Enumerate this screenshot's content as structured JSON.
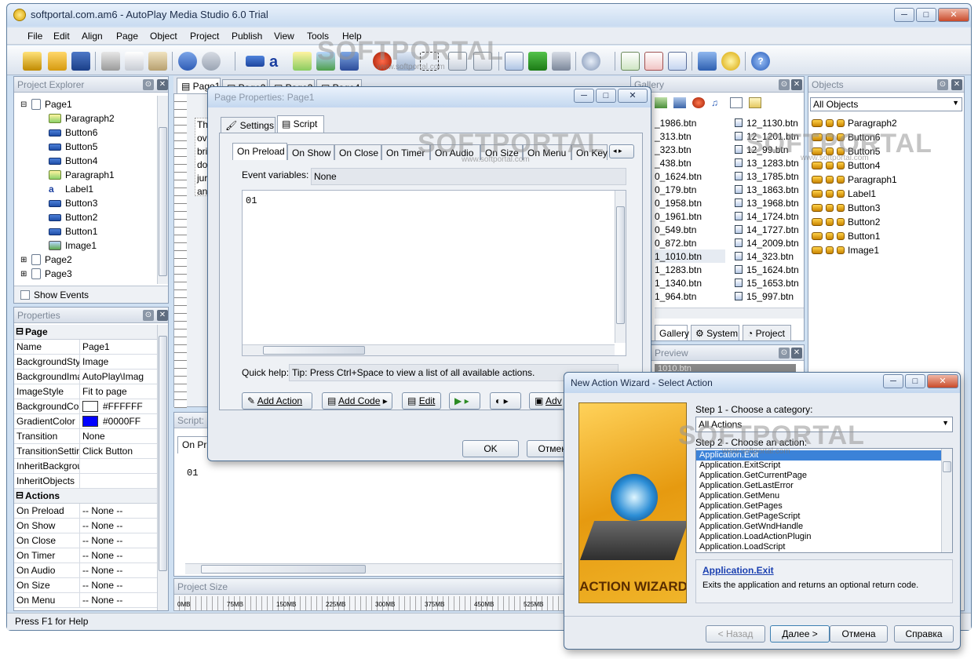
{
  "window": {
    "title": "softportal.com.am6 - AutoPlay Media Studio 6.0 Trial"
  },
  "menu": [
    "File",
    "Edit",
    "Align",
    "Page",
    "Object",
    "Project",
    "Publish",
    "View",
    "Tools",
    "Help"
  ],
  "project_explorer": {
    "title": "Project Explorer",
    "tree": [
      {
        "label": "Page1",
        "icon": "page",
        "level": 0
      },
      {
        "label": "Paragraph2",
        "icon": "paragraph",
        "level": 1
      },
      {
        "label": "Button6",
        "icon": "button",
        "level": 1
      },
      {
        "label": "Button5",
        "icon": "button",
        "level": 1
      },
      {
        "label": "Button4",
        "icon": "button",
        "level": 1
      },
      {
        "label": "Paragraph1",
        "icon": "paragraph",
        "level": 1
      },
      {
        "label": "Label1",
        "icon": "label",
        "level": 1
      },
      {
        "label": "Button3",
        "icon": "button",
        "level": 1
      },
      {
        "label": "Button2",
        "icon": "button",
        "level": 1
      },
      {
        "label": "Button1",
        "icon": "button",
        "level": 1
      },
      {
        "label": "Image1",
        "icon": "image",
        "level": 1
      },
      {
        "label": "Page2",
        "icon": "page",
        "level": 0
      },
      {
        "label": "Page3",
        "icon": "page",
        "level": 0
      }
    ],
    "show_events": "Show Events"
  },
  "properties": {
    "title": "Properties",
    "group_page": "Page",
    "rows": [
      {
        "name": "Name",
        "value": "Page1"
      },
      {
        "name": "BackgroundStyl",
        "value": "Image"
      },
      {
        "name": "BackgroundIma",
        "value": "AutoPlay\\Imag"
      },
      {
        "name": "ImageStyle",
        "value": "Fit to page"
      },
      {
        "name": "BackgroundCol",
        "value": "#FFFFFF",
        "swatch": "#FFFFFF"
      },
      {
        "name": "GradientColor",
        "value": "#0000FF",
        "swatch": "#0000FF"
      },
      {
        "name": "Transition",
        "value": "None"
      },
      {
        "name": "TransitionSettin",
        "value": "Click Button"
      },
      {
        "name": "InheritBackgrou",
        "value": ""
      },
      {
        "name": "InheritObjects",
        "value": ""
      }
    ],
    "group_actions": "Actions",
    "actions": [
      {
        "name": "On Preload",
        "value": "-- None --"
      },
      {
        "name": "On Show",
        "value": "-- None --"
      },
      {
        "name": "On Close",
        "value": "-- None --"
      },
      {
        "name": "On Timer",
        "value": "-- None --"
      },
      {
        "name": "On Audio",
        "value": "-- None --"
      },
      {
        "name": "On Size",
        "value": "-- None --"
      },
      {
        "name": "On Menu",
        "value": "-- None --"
      }
    ]
  },
  "page_tabs": [
    "Page1",
    "Page2",
    "Page3",
    "Page4"
  ],
  "canvas_text": [
    "Th",
    "ov",
    "bri",
    "do",
    "jur",
    "an"
  ],
  "script_panel": {
    "title": "Script:",
    "tab": "On Pr",
    "code": "01"
  },
  "project_size": {
    "title": "Project Size",
    "ticks": [
      "0MB",
      "75MB",
      "150MB",
      "225MB",
      "300MB",
      "375MB",
      "450MB",
      "525MB",
      "600MB",
      "675"
    ]
  },
  "gallery": {
    "title": "Gallery",
    "col1": [
      "_1986.btn",
      "_313.btn",
      "_323.btn",
      "_438.btn",
      "0_1624.btn",
      "0_179.btn",
      "0_1958.btn",
      "0_1961.btn",
      "0_549.btn",
      "0_872.btn",
      "1_1010.btn",
      "1_1283.btn",
      "1_1340.btn",
      "1_964.btn"
    ],
    "col2": [
      "12_1130.btn",
      "12_1201.btn",
      "12_99.btn",
      "13_1283.btn",
      "13_1785.btn",
      "13_1863.btn",
      "13_1968.btn",
      "14_1724.btn",
      "14_1727.btn",
      "14_2009.btn",
      "14_323.btn",
      "15_1624.btn",
      "15_1653.btn",
      "15_997.btn"
    ],
    "tabs": [
      "Gallery",
      "System",
      "Project"
    ],
    "preview_title": "Preview",
    "preview_file": "1010.btn"
  },
  "objects": {
    "title": "Objects",
    "filter": "All Objects",
    "items": [
      "Paragraph2",
      "Button6",
      "Button5",
      "Button4",
      "Paragraph1",
      "Label1",
      "Button3",
      "Button2",
      "Button1",
      "Image1"
    ]
  },
  "status": "Press F1 for Help",
  "page_properties": {
    "title": "Page Properties: Page1",
    "tabs": [
      "Settings",
      "Script"
    ],
    "event_tabs": [
      "On Preload",
      "On Show",
      "On Close",
      "On Timer",
      "On Audio",
      "On Size",
      "On Menu",
      "On Key"
    ],
    "event_vars_label": "Event variables:",
    "event_vars_value": "None",
    "code": "01",
    "quick_help_label": "Quick help:",
    "quick_help_text": "Tip: Press Ctrl+Space to view a list of all available actions.",
    "buttons": {
      "add_action": "Add Action",
      "add_code": "Add Code",
      "edit": "Edit",
      "adv": "Adv"
    },
    "ok": "OK",
    "cancel": "Отмена"
  },
  "wizard": {
    "title": "New Action Wizard - Select Action",
    "art_text": "ACTION WIZARD",
    "step1": "Step 1 - Choose a category:",
    "category": "All Actions",
    "step2": "Step 2 - Choose an action:",
    "actions": [
      "Application.Exit",
      "Application.ExitScript",
      "Application.GetCurrentPage",
      "Application.GetLastError",
      "Application.GetMenu",
      "Application.GetPages",
      "Application.GetPageScript",
      "Application.GetWndHandle",
      "Application.LoadActionPlugin",
      "Application.LoadScript"
    ],
    "selected_name": "Application.Exit",
    "description": "Exits the application and returns an optional return code.",
    "back": "< Назад",
    "next": "Далее >",
    "cancel": "Отмена",
    "help": "Справка"
  },
  "watermark": {
    "brand": "SOFTPORTAL",
    "url": "www.softportal.com"
  }
}
